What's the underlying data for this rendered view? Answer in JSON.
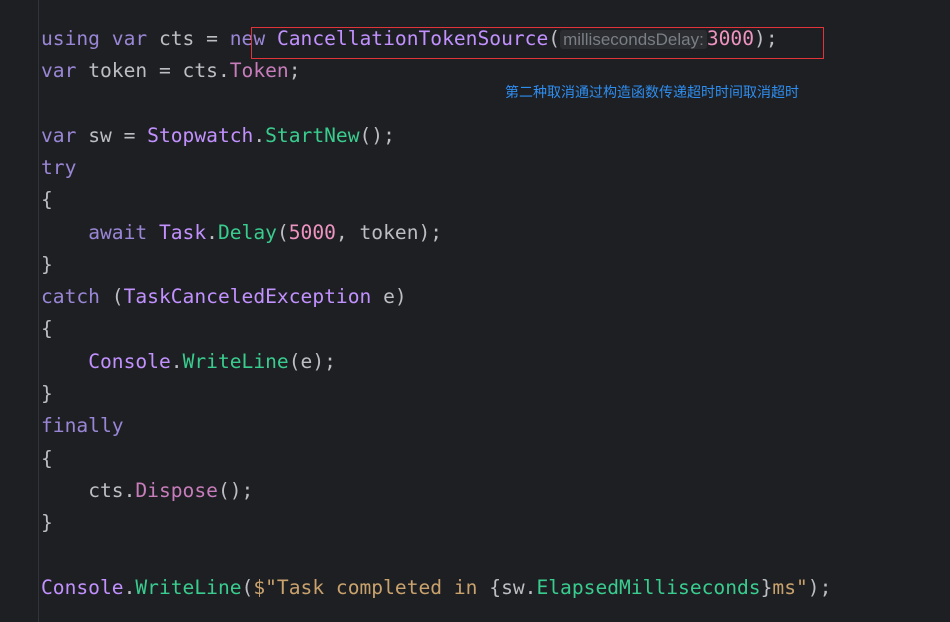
{
  "code": {
    "line1": {
      "kw_using": "using",
      "kw_var": "var",
      "name": "cts",
      "eq": "=",
      "kw_new": "new",
      "type": "CancellationTokenSource",
      "open": "(",
      "hint": "millisecondsDelay:",
      "value": "3000",
      "close": ");"
    },
    "line2": {
      "kw_var": "var",
      "name": "token = cts.",
      "prop": "Token",
      "end": ";"
    },
    "line3": {
      "kw_var": "var",
      "name": "sw =",
      "type": "Stopwatch",
      "dot": ".",
      "method": "StartNew",
      "end": "();"
    },
    "line4": {
      "kw": "try"
    },
    "line5": {
      "brace": "{"
    },
    "line6": {
      "kw_await": "await",
      "type": "Task",
      "dot": ".",
      "method": "Delay",
      "open": "(",
      "value": "5000",
      "rest": ", token);"
    },
    "line7": {
      "brace": "}"
    },
    "line8": {
      "kw": "catch",
      "open": "(",
      "type": "TaskCanceledException",
      "rest": "e)"
    },
    "line9": {
      "brace": "{"
    },
    "line10": {
      "type": "Console",
      "dot": ".",
      "method": "WriteLine",
      "rest": "(e);"
    },
    "line11": {
      "brace": "}"
    },
    "line12": {
      "kw": "finally"
    },
    "line13": {
      "brace": "{"
    },
    "line14": {
      "obj": "cts.",
      "method": "Dispose",
      "rest": "();"
    },
    "line15": {
      "brace": "}"
    },
    "line16": {
      "type": "Console",
      "dot": ".",
      "method": "WriteLine",
      "open": "(",
      "str1": "$\"Task completed in ",
      "brace_open": "{",
      "obj": "sw.",
      "prop": "ElapsedMilliseconds",
      "brace_close": "}",
      "str2": "ms\"",
      "end": ");"
    }
  },
  "annotation": {
    "text": "第二种取消通过构造函数传递超时时间取消超时",
    "color": "#2e8ef0"
  },
  "highlight": {
    "color": "#e0343a"
  }
}
